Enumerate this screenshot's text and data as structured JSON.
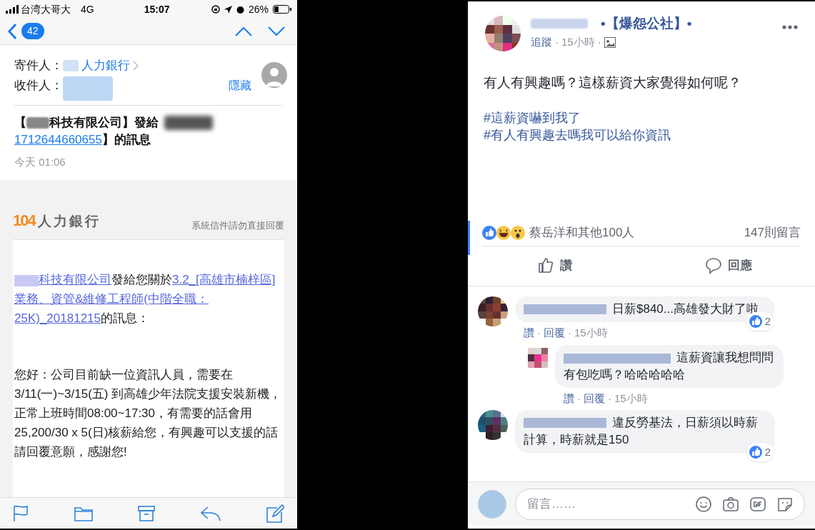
{
  "mail": {
    "status_bar": {
      "carrier": "台湾大哥大",
      "network": "4G",
      "time": "15:07",
      "battery": "26%"
    },
    "nav": {
      "unread_count": "42"
    },
    "header": {
      "from_label": "寄件人：",
      "from_value": "人力銀行",
      "to_label": "收件人：",
      "hide_link": "隱藏"
    },
    "subject": {
      "open": "【",
      "company": "科技有限公司】發給",
      "link": "1712644660655",
      "close": "】的訊息"
    },
    "date": "今天 01:06",
    "banner": {
      "logo_number": "104",
      "logo_text": "人力銀行",
      "notice": "系統信件請勿直接回覆"
    },
    "body": {
      "company_link": "科技有限公司",
      "intro": "發給您關於",
      "job_link": "3.2_[高雄市楠梓區]業務、資管&維修工程師(中階全職：25K)_20181215",
      "intro_end": "的訊息：",
      "message": "您好：公司目前缺一位資訊人員，需要在3/11(一)~3/15(五) 到高雄少年法院支援安裝新機，正常上班時間08:00~17:30，有需要的話會用25,200/30 x 5(日)核薪給您，有興趣可以支援的話請回覆意願，感謝您!"
    }
  },
  "post": {
    "group": "•【爆怨公社】•",
    "follow": "追蹤",
    "separators": [
      "·",
      "·"
    ],
    "time": "15小時",
    "text": "有人有興趣嗎？這樣薪資大家覺得如何呢？",
    "hashtags": [
      "#這薪資嚇到我了",
      "#有人有興趣去嗎我可以給你資訊"
    ],
    "reactions_text": "蔡岳洋和其他100人",
    "comments_count": "147則留言",
    "actions": [
      "讚",
      "回應"
    ],
    "comments": [
      {
        "text": "日薪$840...高雄發大財了啦",
        "likes": "2",
        "like_link": "讚",
        "reply_link": "回覆",
        "separators": [
          "·",
          "·"
        ],
        "time": "15小時",
        "children": [
          {
            "text": "這薪資讓我想問問有包吃嗎？哈哈哈哈哈",
            "like_link": "讚",
            "reply_link": "回覆",
            "separators": [
              "·",
              "·"
            ],
            "time": "15小時"
          }
        ]
      },
      {
        "text": "違反勞基法，日薪須以時薪計算，時薪就是150",
        "likes": "2"
      }
    ],
    "composer": {
      "placeholder": "留言……"
    }
  }
}
